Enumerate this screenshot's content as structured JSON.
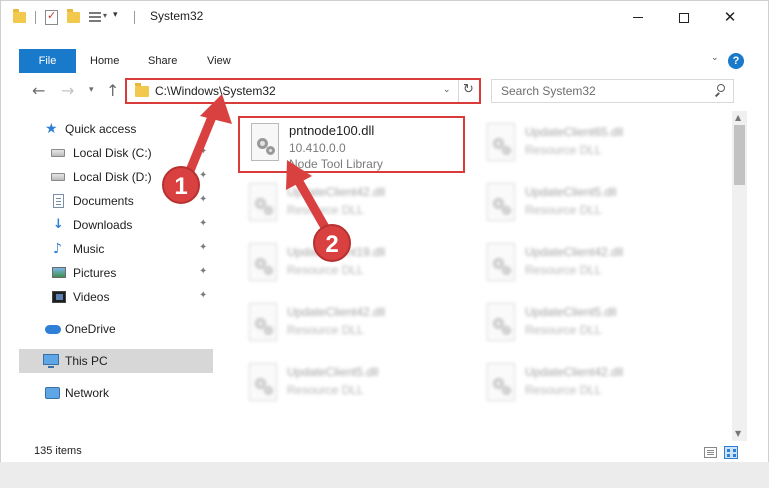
{
  "window": {
    "title": "System32"
  },
  "ribbon": {
    "tabs": [
      {
        "label": "File"
      },
      {
        "label": "Home"
      },
      {
        "label": "Share"
      },
      {
        "label": "View"
      }
    ],
    "help_label": "?"
  },
  "navigation": {
    "address_path": "C:\\Windows\\System32",
    "search_placeholder": "Search System32"
  },
  "sidebar": {
    "items": [
      {
        "label": "Quick access",
        "icon": "star-icon"
      },
      {
        "label": "Local Disk (C:)",
        "icon": "disk-icon",
        "pinned": true
      },
      {
        "label": "Local Disk (D:)",
        "icon": "disk-icon",
        "pinned": true
      },
      {
        "label": "Documents",
        "icon": "documents-icon",
        "pinned": true
      },
      {
        "label": "Downloads",
        "icon": "downloads-icon",
        "pinned": true
      },
      {
        "label": "Music",
        "icon": "music-icon",
        "pinned": true
      },
      {
        "label": "Pictures",
        "icon": "pictures-icon",
        "pinned": true
      },
      {
        "label": "Videos",
        "icon": "videos-icon",
        "pinned": true
      },
      {
        "label": "OneDrive",
        "icon": "cloud-icon"
      },
      {
        "label": "This PC",
        "icon": "computer-icon",
        "selected": true
      },
      {
        "label": "Network",
        "icon": "network-icon"
      }
    ]
  },
  "files": [
    {
      "name": "pntnode100.dll",
      "version": "10.410.0.0",
      "description": "Node Tool Library"
    },
    {
      "name": "UpdateClient65.dll",
      "description": "Resource DLL"
    },
    {
      "name": "UpdateClient42.dll",
      "description": "Resource DLL"
    },
    {
      "name": "UpdateClient5.dll",
      "description": "Resource DLL"
    },
    {
      "name": "UpdateClient19.dll",
      "description": "Resource DLL"
    },
    {
      "name": "UpdateClient42.dll",
      "description": "Resource DLL"
    },
    {
      "name": "UpdateClient42.dll",
      "description": "Resource DLL"
    },
    {
      "name": "UpdateClient5.dll",
      "description": "Resource DLL"
    },
    {
      "name": "UpdateClient5.dll",
      "description": "Resource DLL"
    },
    {
      "name": "UpdateClient42.dll",
      "description": "Resource DLL"
    }
  ],
  "status": {
    "item_count": "135 items"
  },
  "annotations": {
    "step1": "1",
    "step2": "2"
  },
  "colors": {
    "accent": "#1979ca",
    "highlight": "#d93a3a",
    "selected_bg": "#d7d7d7"
  }
}
